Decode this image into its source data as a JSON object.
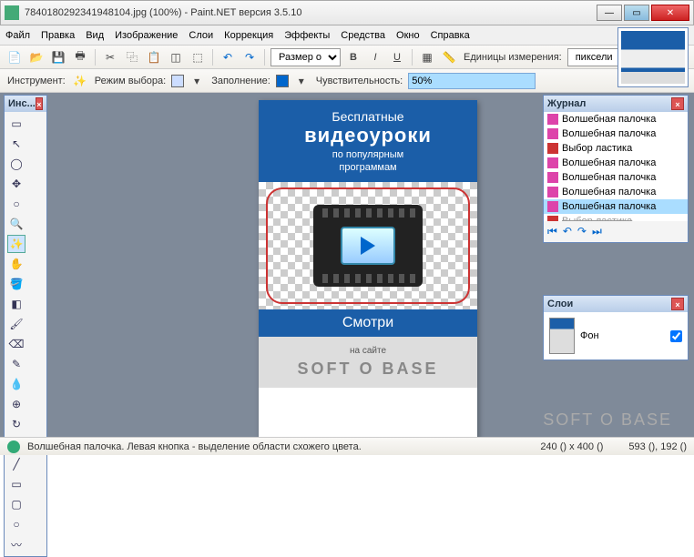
{
  "titlebar": {
    "text": "7840180292341948104.jpg (100%) - Paint.NET версия 3.5.10"
  },
  "menu": [
    "Файл",
    "Правка",
    "Вид",
    "Изображение",
    "Слои",
    "Коррекция",
    "Эффекты",
    "Средства",
    "Окно",
    "Справка"
  ],
  "toolbar1": {
    "size_label": "Размер о",
    "units_label": "Единицы измерения:",
    "units_value": "пиксели"
  },
  "toolbar2": {
    "instrument": "Инструмент:",
    "mode": "Режим выбора:",
    "fill": "Заполнение:",
    "sensitivity": "Чувствительность:",
    "sensitivity_value": "50%"
  },
  "tools_panel": {
    "title": "Инс..."
  },
  "history": {
    "title": "Журнал",
    "items": [
      {
        "label": "Волшебная палочка",
        "kind": "wand",
        "state": ""
      },
      {
        "label": "Волшебная палочка",
        "kind": "wand",
        "state": ""
      },
      {
        "label": "Выбор ластика",
        "kind": "era",
        "state": ""
      },
      {
        "label": "Волшебная палочка",
        "kind": "wand",
        "state": ""
      },
      {
        "label": "Волшебная палочка",
        "kind": "wand",
        "state": ""
      },
      {
        "label": "Волшебная палочка",
        "kind": "wand",
        "state": ""
      },
      {
        "label": "Волшебная палочка",
        "kind": "wand",
        "state": "sel"
      },
      {
        "label": "Выбор ластика",
        "kind": "era",
        "state": "dis"
      }
    ]
  },
  "layers": {
    "title": "Слои",
    "item": "Фон"
  },
  "banner": {
    "l1": "Бесплатные",
    "l2": "видеоуроки",
    "l3a": "по популярным",
    "l3b": "программам",
    "btn": "Смотри",
    "foot1": "на сайте",
    "foot2": "SOFT O BASE"
  },
  "statusbar": {
    "text": "Волшебная палочка. Левая кнопка - выделение области схожего цвета.",
    "dims": "240 () x 400 ()",
    "coords": "593 (), 192 ()"
  },
  "watermark": "SOFT O BASE"
}
